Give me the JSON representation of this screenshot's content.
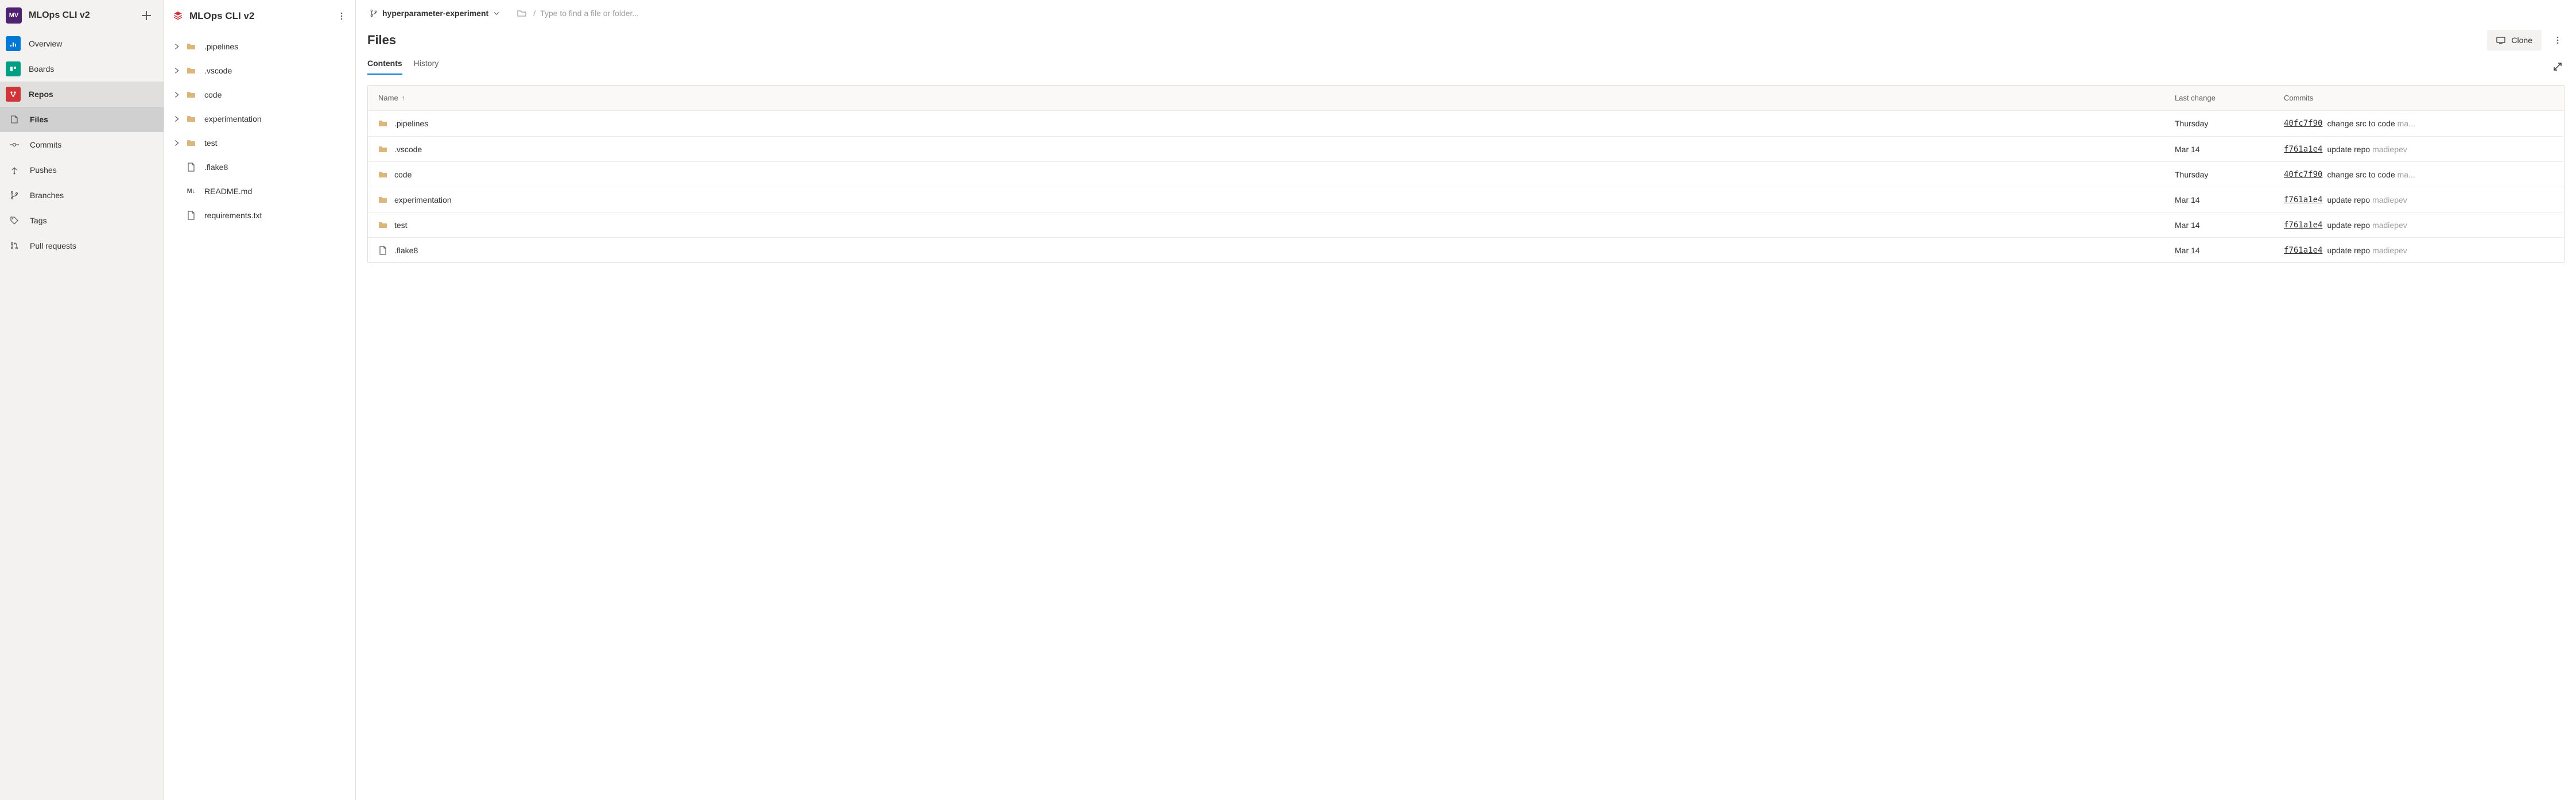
{
  "project": {
    "avatar": "MV",
    "name": "MLOps CLI v2"
  },
  "leftnav": {
    "overview": "Overview",
    "boards": "Boards",
    "repos": "Repos",
    "files": "Files",
    "commits": "Commits",
    "pushes": "Pushes",
    "branches": "Branches",
    "tags": "Tags",
    "pullrequests": "Pull requests"
  },
  "tree": {
    "repo_name": "MLOps CLI v2",
    "items": [
      {
        "type": "folder",
        "name": ".pipelines",
        "expandable": true
      },
      {
        "type": "folder",
        "name": ".vscode",
        "expandable": true
      },
      {
        "type": "folder",
        "name": "code",
        "expandable": true
      },
      {
        "type": "folder",
        "name": "experimentation",
        "expandable": true
      },
      {
        "type": "folder",
        "name": "test",
        "expandable": true
      },
      {
        "type": "file",
        "name": ".flake8",
        "expandable": false
      },
      {
        "type": "md",
        "name": "README.md",
        "expandable": false
      },
      {
        "type": "file",
        "name": "requirements.txt",
        "expandable": false
      }
    ]
  },
  "branch": {
    "name": "hyperparameter-experiment"
  },
  "path_placeholder": "Type to find a file or folder...",
  "page_title": "Files",
  "clone_label": "Clone",
  "tabs": {
    "contents": "Contents",
    "history": "History"
  },
  "table": {
    "head": {
      "name": "Name",
      "last_change": "Last change",
      "commits": "Commits"
    },
    "rows": [
      {
        "type": "folder",
        "name": ".pipelines",
        "changed": "Thursday",
        "hash": "40fc7f90",
        "msg": "change src to code",
        "author": "ma..."
      },
      {
        "type": "folder",
        "name": ".vscode",
        "changed": "Mar 14",
        "hash": "f761a1e4",
        "msg": "update repo",
        "author": "madiepev"
      },
      {
        "type": "folder",
        "name": "code",
        "changed": "Thursday",
        "hash": "40fc7f90",
        "msg": "change src to code",
        "author": "ma..."
      },
      {
        "type": "folder",
        "name": "experimentation",
        "changed": "Mar 14",
        "hash": "f761a1e4",
        "msg": "update repo",
        "author": "madiepev"
      },
      {
        "type": "folder",
        "name": "test",
        "changed": "Mar 14",
        "hash": "f761a1e4",
        "msg": "update repo",
        "author": "madiepev"
      },
      {
        "type": "file",
        "name": ".flake8",
        "changed": "Mar 14",
        "hash": "f761a1e4",
        "msg": "update repo",
        "author": "madiepev"
      }
    ]
  }
}
